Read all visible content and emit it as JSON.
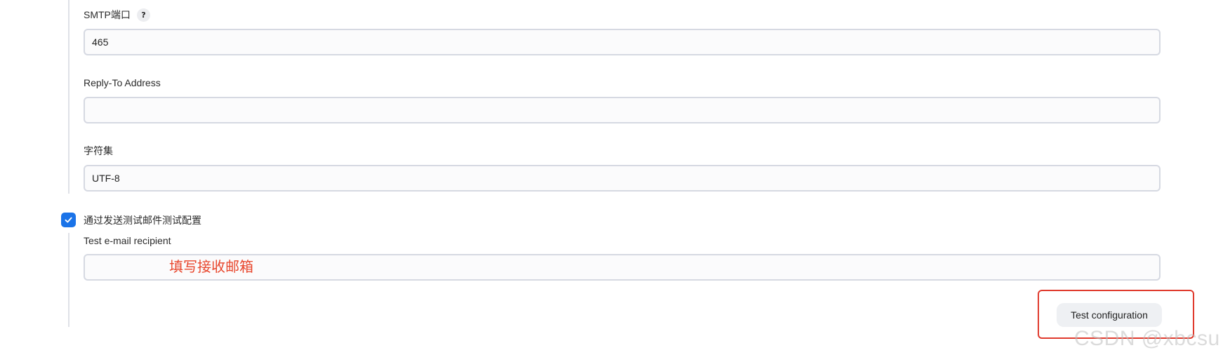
{
  "form": {
    "smtp_port": {
      "label": "SMTP端口",
      "help_icon": "?",
      "value": "465"
    },
    "reply_to": {
      "label": "Reply-To Address",
      "value": ""
    },
    "charset": {
      "label": "字符集",
      "value": "UTF-8"
    },
    "test_mail": {
      "checkbox_label": "通过发送测试邮件测试配置",
      "checked": true,
      "recipient_label": "Test e-mail recipient",
      "recipient_value": "",
      "annotation": "填写接收邮箱"
    },
    "test_button_label": "Test configuration"
  },
  "watermark": "CSDN @xbcsu",
  "colors": {
    "checkbox": "#1a73e8",
    "annotation": "#e8462c",
    "highlight_box": "#e03a2d"
  }
}
